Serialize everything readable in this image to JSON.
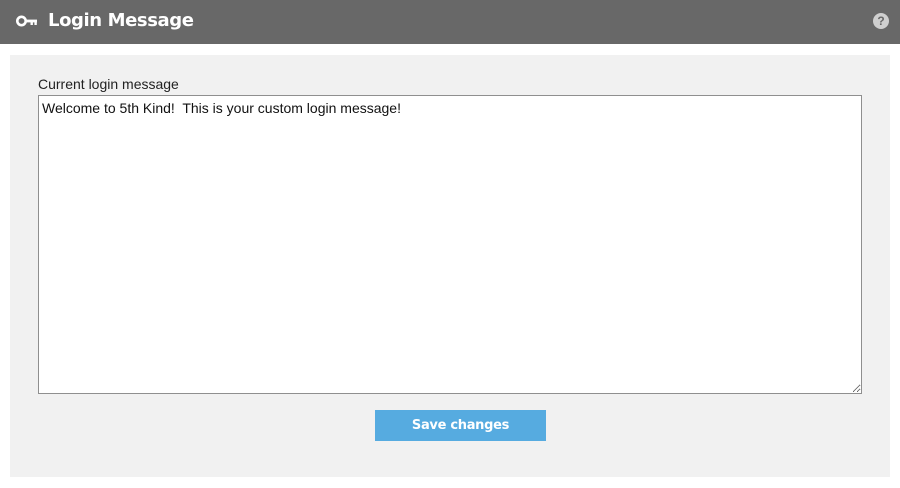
{
  "header": {
    "title": "Login Message",
    "icon": "key-icon",
    "help_icon_label": "?",
    "background_color": "#686868"
  },
  "form": {
    "label": "Current login message",
    "message_value": "Welcome to 5th Kind!  This is your custom login message!",
    "save_label": "Save changes",
    "button_color": "#56abe0"
  }
}
